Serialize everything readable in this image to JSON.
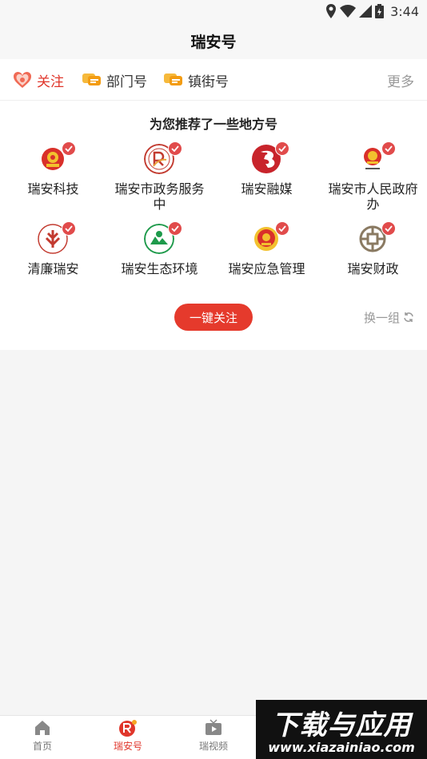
{
  "status_bar": {
    "time": "3:44"
  },
  "header": {
    "title": "瑞安号"
  },
  "tabs": [
    {
      "label": "关注",
      "icon": "heart-badge-icon",
      "active": true
    },
    {
      "label": "部门号",
      "icon": "chat-badge-icon",
      "active": false
    },
    {
      "label": "镇街号",
      "icon": "chat-badge-icon",
      "active": false
    }
  ],
  "tabs_more": "更多",
  "recommend": {
    "title": "为您推荐了一些地方号",
    "items": [
      {
        "label": "瑞安科技",
        "icon": "national-emblem-icon"
      },
      {
        "label": "瑞安市政务服务中",
        "icon": "service-center-logo-icon"
      },
      {
        "label": "瑞安融媒",
        "icon": "media-logo-icon"
      },
      {
        "label": "瑞安市人民政府办",
        "icon": "national-emblem-icon"
      },
      {
        "label": "清廉瑞安",
        "icon": "integrity-logo-icon"
      },
      {
        "label": "瑞安生态环境",
        "icon": "environment-logo-icon"
      },
      {
        "label": "瑞安应急管理",
        "icon": "emergency-emblem-icon"
      },
      {
        "label": "瑞安财政",
        "icon": "finance-logo-icon"
      }
    ],
    "follow_all": "一键关注",
    "refresh": "换一组"
  },
  "bottom_nav": [
    {
      "label": "首页",
      "icon": "home-icon",
      "active": false
    },
    {
      "label": "瑞安号",
      "icon": "ruian-r-icon",
      "active": true
    },
    {
      "label": "瑞视频",
      "icon": "tv-play-icon",
      "active": false
    }
  ],
  "watermark": {
    "main": "下载与应用",
    "sub": "www.xiazainiao.com"
  },
  "colors": {
    "accent": "#e0362b",
    "check": "#e14b4b",
    "muted": "#999999"
  }
}
